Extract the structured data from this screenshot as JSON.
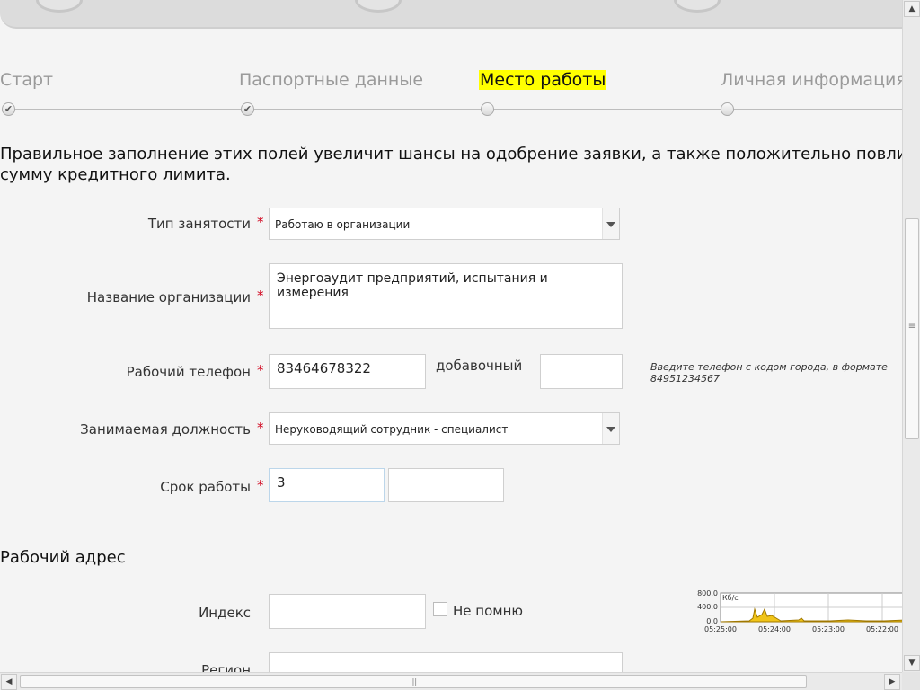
{
  "stepper": {
    "steps": [
      {
        "label": "Старт",
        "state": "done"
      },
      {
        "label": "Паспортные данные",
        "state": "done"
      },
      {
        "label": "Место работы",
        "state": "active"
      },
      {
        "label": "Личная информация",
        "state": "pending"
      }
    ]
  },
  "intro": {
    "line1": "Правильное заполнение этих полей увеличит шансы на одобрение заявки, а также положительно повлияет на",
    "line2": "сумму кредитного лимита."
  },
  "form": {
    "employment_type": {
      "label": "Тип занятости",
      "value": "Работаю в организации"
    },
    "org_name": {
      "label": "Название организации",
      "value": "Энергоаудит предприятий, испытания и измерения"
    },
    "work_phone": {
      "label": "Рабочий телефон",
      "value": "83464678322",
      "ext_label": "добавочный",
      "ext_value": "",
      "hint_line1": "Введите телефон с кодом города, в формате",
      "hint_line2": "84951234567"
    },
    "position": {
      "label": "Занимаемая должность",
      "value": "Неруководящий сотрудник - специалист"
    },
    "tenure": {
      "label": "Срок работы",
      "value1": "3",
      "value2": ""
    },
    "required_mark": "*"
  },
  "work_address": {
    "title": "Рабочий адрес",
    "index_label": "Индекс",
    "index_value": "",
    "dont_remember_label": "Не помню",
    "region_label": "Регион"
  },
  "net_graph": {
    "unit": "Кб/с",
    "y_labels": [
      "800,0",
      "400,0",
      "0,0"
    ],
    "x_labels": [
      "05:25:00",
      "05:24:00",
      "05:23:00",
      "05:22:00"
    ],
    "fill_color": "#f0c419",
    "line_color": "#a07800"
  },
  "scrollbars": {
    "up": "▲",
    "down": "▼",
    "left": "◀",
    "right": "▶",
    "grip": "≡",
    "grip_h": "|||"
  },
  "icons": {
    "check": "✔"
  }
}
